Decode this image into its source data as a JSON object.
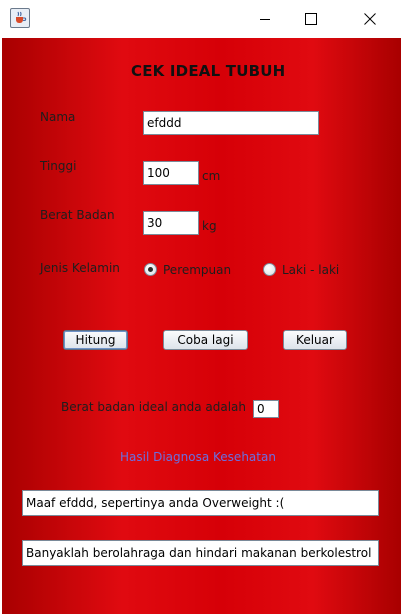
{
  "window": {
    "icon": "java-cup-icon",
    "controls": {
      "minimize": "minimize-icon",
      "maximize": "maximize-icon",
      "close": "close-icon"
    }
  },
  "form": {
    "title": "CEK IDEAL TUBUH",
    "nama_label": "Nama",
    "nama_value": "efddd",
    "tinggi_label": "Tinggi",
    "tinggi_value": "100",
    "tinggi_unit": "cm",
    "berat_label": "Berat Badan",
    "berat_value": "30",
    "berat_unit": "kg",
    "kelamin_label": "Jenis Kelamin",
    "kelamin_options": [
      {
        "label": "Perempuan",
        "selected": true
      },
      {
        "label": "Laki - laki",
        "selected": false
      }
    ]
  },
  "buttons": {
    "hitung": "Hitung",
    "coba_lagi": "Coba lagi",
    "keluar": "Keluar"
  },
  "result": {
    "ideal_label": "Berat badan ideal anda adalah",
    "ideal_value": "0",
    "diagnosa_label": "Hasil Diagnosa Kesehatan",
    "diagnosa_line1": "Maaf efddd, sepertinya anda Overweight :(",
    "diagnosa_line2": "Banyaklah berolahraga dan hindari makanan berkolestrol"
  },
  "colors": {
    "background_red": "#d60007",
    "diagnosa_text": "#6b6fe0"
  }
}
